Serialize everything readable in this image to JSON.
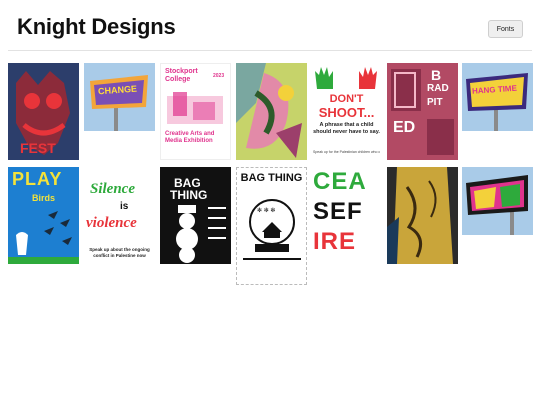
{
  "header": {
    "title": "Knight Designs",
    "fonts_button_label": "Fonts"
  },
  "gallery": {
    "row1": [
      {
        "name": "red-creature-poster"
      },
      {
        "name": "change-billboard",
        "text": "CHANGE"
      },
      {
        "name": "stockport-college-poster",
        "college": "Stockport College",
        "year": "2023",
        "title": "Creative Arts and Media Exhibition"
      },
      {
        "name": "green-abstract-poster"
      },
      {
        "name": "dont-shoot-poster",
        "headline_1": "DON'T",
        "headline_2": "SHOOT...",
        "caption": "A phrase that a child should never have to say.",
        "footnote": "Speak up for the Palestinian children who can't"
      },
      {
        "name": "brad-pitt-poster",
        "text_1": "B",
        "text_2": "RAD",
        "text_3": "PIT",
        "text_4": "ED"
      },
      {
        "name": "hang-time-billboard",
        "text": "HANG TIME"
      }
    ],
    "row2": [
      {
        "name": "play-magazine-cover",
        "masthead": "PLAY",
        "subtitle": "Birds"
      },
      {
        "name": "violence-poster",
        "top": "Silence",
        "mid": "is",
        "bottom": "violence",
        "caption": "Speak up about the ongoing conflict in Palestine now"
      },
      {
        "name": "bag-thing-snowman-poster",
        "title_1": "BAG",
        "title_2": "THING"
      },
      {
        "name": "bag-thing-snowglobe-poster",
        "title": "BAG THING"
      },
      {
        "name": "ceasefire-poster",
        "line_1": "CEA",
        "line_2": "SEF",
        "line_3": "IRE"
      },
      {
        "name": "yellow-jacket-photo"
      },
      {
        "name": "colourful-billboard"
      }
    ]
  },
  "colors": {
    "accent_red": "#e8343a",
    "accent_green": "#2eaa3c",
    "sky_blue": "#a9cbe8",
    "play_blue": "#1d7fd1"
  }
}
